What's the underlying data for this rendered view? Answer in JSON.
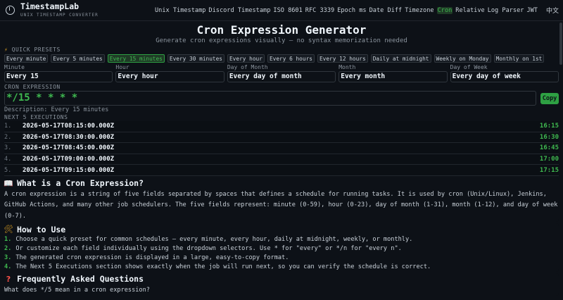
{
  "brand": {
    "name": "TimestampLab",
    "subtitle": "UNIX TIMESTAMP CONVERTER"
  },
  "nav": {
    "items": [
      "Unix Timestamp",
      "Discord Timestamp",
      "ISO 8601",
      "RFC 3339",
      "Epoch ms",
      "Date Diff",
      "Timezone",
      "Cron",
      "Relative",
      "Log Parser",
      "JWT"
    ],
    "active": "Cron",
    "lang": "中文"
  },
  "page": {
    "title": "Cron Expression Generator",
    "subtitle": "Generate cron expressions visually — no syntax memorization needed"
  },
  "presets": {
    "label": "QUICK PRESETS",
    "items": [
      "Every minute",
      "Every 5 minutes",
      "Every 15 minutes",
      "Every 30 minutes",
      "Every hour",
      "Every 6 hours",
      "Every 12 hours",
      "Daily at midnight",
      "Weekly on Monday",
      "Monthly on 1st"
    ],
    "active": "Every 15 minutes"
  },
  "fields": {
    "minute": {
      "label": "Minute",
      "value": "Every 15"
    },
    "hour": {
      "label": "Hour",
      "value": "Every hour"
    },
    "day_of_month": {
      "label": "Day of Month",
      "value": "Every day of month"
    },
    "month": {
      "label": "Month",
      "value": "Every month"
    },
    "day_of_week": {
      "label": "Day of Week",
      "value": "Every day of week"
    }
  },
  "expression": {
    "label": "CRON EXPRESSION",
    "value": "*/15 * * * *",
    "copy_label": "Copy",
    "description": "Description: Every 15 minutes"
  },
  "next": {
    "label": "NEXT 5 EXECUTIONS",
    "rows": [
      {
        "idx": "1.",
        "ts": "2026-05-17T08:15:00.000Z",
        "time": "16:15"
      },
      {
        "idx": "2.",
        "ts": "2026-05-17T08:30:00.000Z",
        "time": "16:30"
      },
      {
        "idx": "3.",
        "ts": "2026-05-17T08:45:00.000Z",
        "time": "16:45"
      },
      {
        "idx": "4.",
        "ts": "2026-05-17T09:00:00.000Z",
        "time": "17:00"
      },
      {
        "idx": "5.",
        "ts": "2026-05-17T09:15:00.000Z",
        "time": "17:15"
      }
    ]
  },
  "what": {
    "title": "What is a Cron Expression?",
    "body": "A cron expression is a string of five fields separated by spaces that defines a schedule for running tasks. It is used by cron (Unix/Linux), Jenkins, GitHub Actions, and many other job schedulers. The five fields represent: minute (0-59), hour (0-23), day of month (1-31), month (1-12), and day of week (0-7)."
  },
  "how": {
    "title": "How to Use",
    "steps": [
      {
        "num": "1.",
        "text": "Choose a quick preset for common schedules — every minute, every hour, daily at midnight, weekly, or monthly."
      },
      {
        "num": "2.",
        "text": "Or customize each field individually using the dropdown selectors. Use * for \"every\" or */n for \"every n\"."
      },
      {
        "num": "3.",
        "text": "The generated cron expression is displayed in a large, easy-to-copy format."
      },
      {
        "num": "4.",
        "text": "The Next 5 Executions section shows exactly when the job will run next, so you can verify the schedule is correct."
      }
    ]
  },
  "faq": {
    "title": "Frequently Asked Questions",
    "first_question": "What does */5 mean in a cron expression?"
  }
}
